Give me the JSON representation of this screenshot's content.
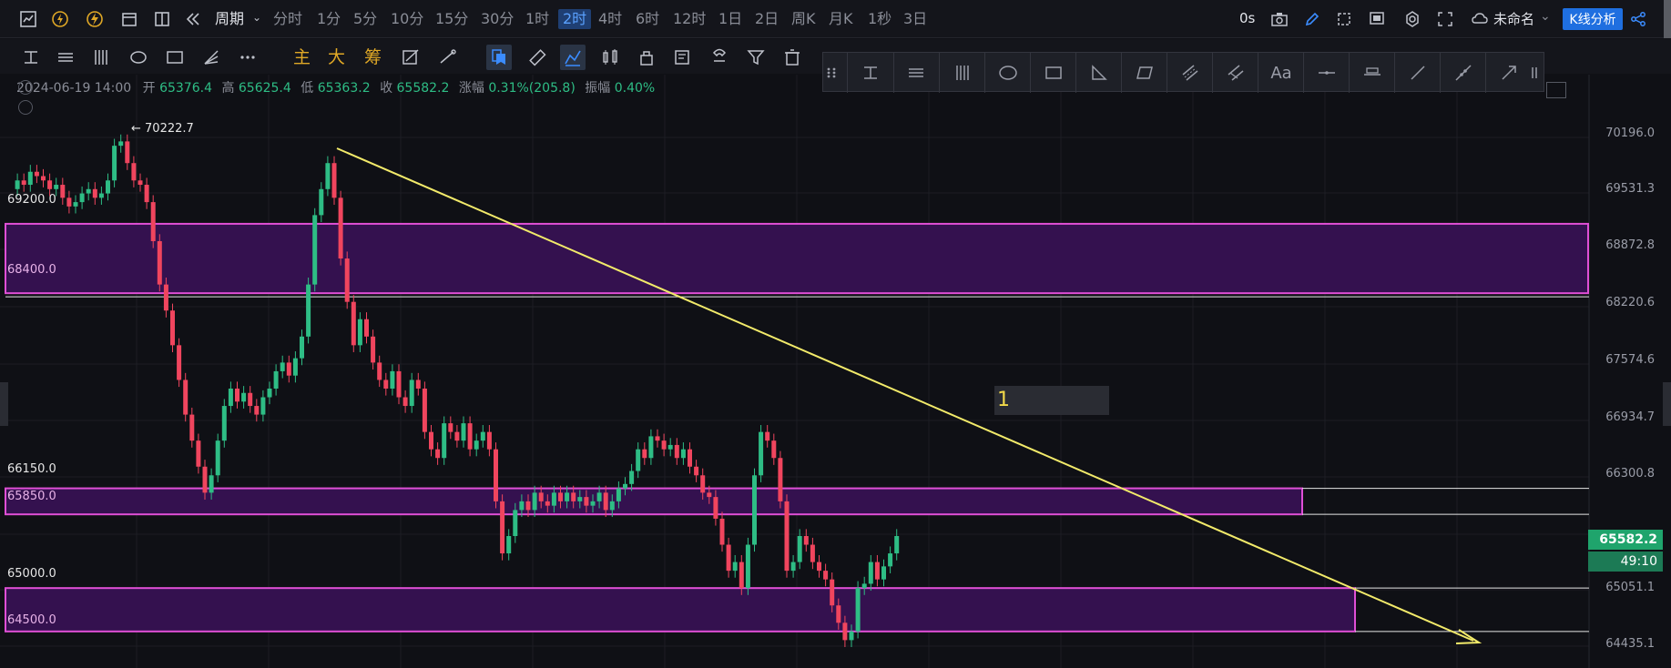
{
  "topbar": {
    "period_label": "周期",
    "periods": [
      "分时",
      "1分",
      "5分",
      "10分",
      "15分",
      "30分",
      "1时",
      "2时",
      "4时",
      "6时",
      "12时",
      "1日",
      "2日",
      "周K",
      "月K",
      "1秒",
      "3日"
    ],
    "active_period": "2时",
    "timer_label": "0s",
    "workspace_name": "未命名",
    "analysis_button": "K线分析"
  },
  "toolbar": {
    "indicator_buttons": [
      "主",
      "大",
      "筹"
    ]
  },
  "float_toolbar": {
    "text_tool": "Aa"
  },
  "ohlc": {
    "datetime": "2024-06-19 14:00",
    "open_label": "开",
    "open": "65376.4",
    "high_label": "高",
    "high": "65625.4",
    "low_label": "低",
    "low": "65363.2",
    "close_label": "收",
    "close": "65582.2",
    "change_label": "涨幅",
    "change": "0.31%(205.8)",
    "amplitude_label": "振幅",
    "amplitude": "0.40%"
  },
  "price_axis": [
    "70196.0",
    "69531.3",
    "68872.8",
    "68220.6",
    "67574.6",
    "66934.7",
    "66300.8",
    "65051.1",
    "64435.1"
  ],
  "levels": {
    "l69200": "69200.0",
    "l68400": "68400.0",
    "l66150": "66150.0",
    "l65850": "65850.0",
    "l65000": "65000.0",
    "l64500": "64500.0"
  },
  "high_marker": "← 70222.7",
  "current_price": "65582.2",
  "candle_timer": "49:10",
  "annotation_text": "1",
  "colors": {
    "up": "#2ebd85",
    "down": "#f0455e",
    "zone_fill": "#34114f",
    "zone_border": "#e04fd6",
    "trend_line": "#f2ea6a",
    "accent": "#1f6fe0"
  }
}
